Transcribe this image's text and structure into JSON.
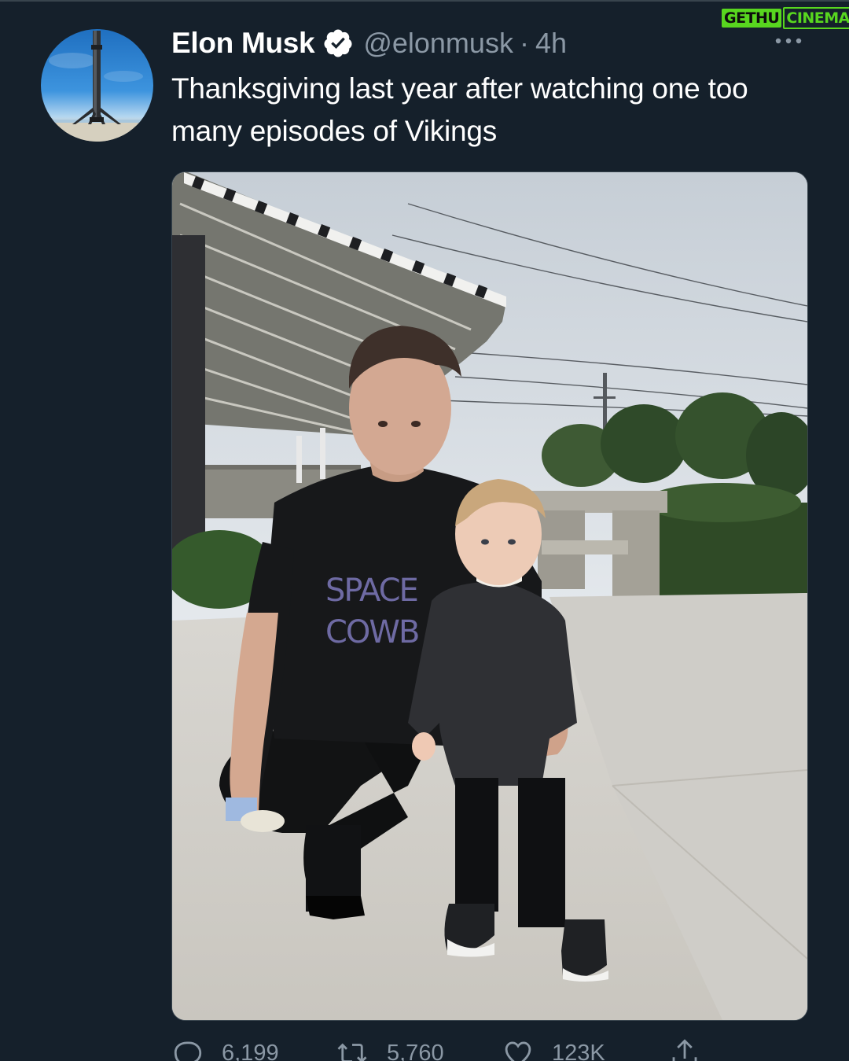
{
  "watermark": {
    "part1": "GETHU",
    "part2": "CINEMA"
  },
  "tweet": {
    "display_name": "Elon Musk",
    "handle": "@elonmusk",
    "separator": "·",
    "time": "4h",
    "text": "Thanksgiving last year after watching one too many episodes of Vikings",
    "photo_shirt_text_1": "SPACE",
    "photo_shirt_text_2": "COWB"
  },
  "actions": {
    "replies": "6,199",
    "retweets": "5,760",
    "likes": "123K"
  },
  "icons": {
    "verified": "verified-badge-icon",
    "more": "more-options-icon",
    "reply": "reply-icon",
    "retweet": "retweet-icon",
    "like": "heart-icon",
    "share": "share-icon"
  },
  "colors": {
    "background": "#15202b",
    "secondary_text": "#8b98a5",
    "watermark_green": "#58d61f"
  }
}
